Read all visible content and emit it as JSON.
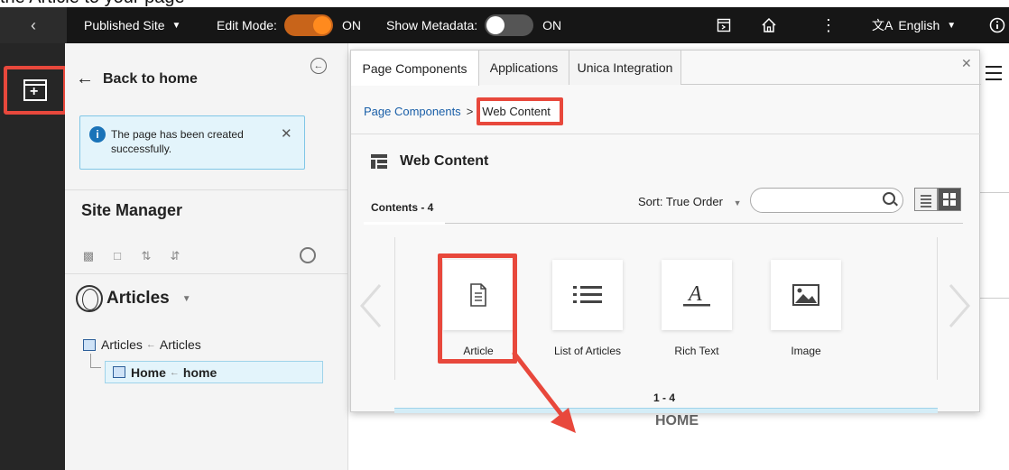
{
  "caption": "the Article to your page",
  "toolbar": {
    "published_site_label": "Published Site",
    "edit_mode_label": "Edit Mode:",
    "edit_mode_state": "ON",
    "show_metadata_label": "Show Metadata:",
    "show_metadata_state": "ON",
    "language_label": "English"
  },
  "site_manager": {
    "back_label": "Back to home",
    "toast_message": "The page has been created successfully.",
    "title": "Site Manager",
    "site_name": "Articles",
    "tree": {
      "root": "Articles",
      "root_alias": "Articles",
      "child": "Home",
      "child_alias": "home"
    }
  },
  "dialog": {
    "tabs": [
      {
        "label": "Page Components"
      },
      {
        "label": "Applications"
      },
      {
        "label": "Unica Integration"
      }
    ],
    "breadcrumb": {
      "parent": "Page Components",
      "separator": ">",
      "current": "Web Content"
    },
    "section_title": "Web Content",
    "contents_label": "Contents - 4",
    "sort_label": "Sort:",
    "sort_value": "True Order",
    "search_placeholder": "",
    "items": [
      {
        "label": "Article",
        "icon": "document-icon"
      },
      {
        "label": "List of Articles",
        "icon": "list-icon"
      },
      {
        "label": "Rich Text",
        "icon": "text-format-icon"
      },
      {
        "label": "Image",
        "icon": "image-icon"
      }
    ],
    "pager": "1 - 4"
  },
  "page": {
    "home_label": "HOME"
  },
  "colors": {
    "highlight": "#e8483c",
    "toggle_on": "#ff8a1e",
    "toolbar_bg": "#161616"
  }
}
